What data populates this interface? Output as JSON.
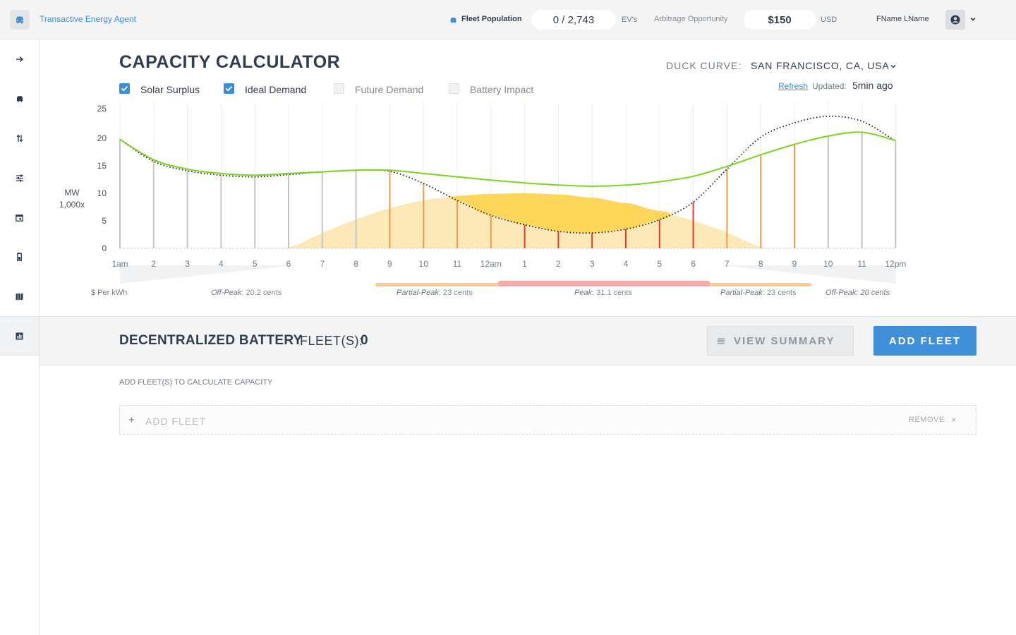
{
  "header": {
    "app_title": "Transactive Energy Agent",
    "fleet_population_label": "Fleet Population",
    "fleet_population_value": "0 / 2,743",
    "fleet_population_unit": "EV's",
    "arbitrage_label": "Arbitrage Opportunity",
    "arbitrage_value": "$150",
    "arbitrage_unit": "USD",
    "user_name": "FName LName"
  },
  "sidebar": {
    "items": [
      {
        "icon": "arrow-right-icon"
      },
      {
        "icon": "car-icon"
      },
      {
        "icon": "transfer-arrows-icon"
      },
      {
        "icon": "sliders-icon"
      },
      {
        "icon": "calendar-icon"
      },
      {
        "icon": "battery-icon"
      },
      {
        "icon": "map-icon"
      },
      {
        "icon": "bar-chart-icon",
        "active": true
      }
    ]
  },
  "calculator": {
    "title": "CAPACITY CALCULATOR",
    "duck_curve_label": "DUCK CURVE:",
    "duck_curve_value": "SAN FRANCISCO, CA, USA",
    "refresh_label": "Refresh",
    "updated_label": "Updated:",
    "updated_value": "5min ago",
    "checkboxes": [
      {
        "label": "Solar Surplus",
        "checked": true
      },
      {
        "label": "Ideal Demand",
        "checked": true
      },
      {
        "label": "Future Demand",
        "checked": false
      },
      {
        "label": "Battery Impact",
        "checked": false
      }
    ]
  },
  "chart_data": {
    "type": "line",
    "ylabel_line1": "MW",
    "ylabel_line2": "1,000x",
    "yticks": [
      0,
      5,
      10,
      15,
      20,
      25
    ],
    "ylim": [
      0,
      25
    ],
    "x": [
      "1am",
      "2",
      "3",
      "4",
      "5",
      "6",
      "7",
      "8",
      "9",
      "10",
      "11",
      "12am",
      "1",
      "2",
      "3",
      "4",
      "5",
      "6",
      "7",
      "8",
      "9",
      "10",
      "11",
      "12pm"
    ],
    "series": [
      {
        "key": "green",
        "color": "#7ed321",
        "values": [
          19.8,
          16.1,
          14.4,
          13.6,
          13.3,
          13.6,
          13.9,
          14.2,
          14.2,
          13.6,
          13.0,
          12.4,
          11.9,
          11.5,
          11.3,
          11.5,
          12.1,
          13.1,
          14.9,
          17.0,
          18.9,
          20.4,
          21.1,
          19.6
        ]
      },
      {
        "key": "dotted",
        "color": "#1a1a1a",
        "values": [
          19.8,
          15.8,
          14.1,
          13.3,
          13.0,
          13.4,
          13.9,
          14.2,
          14.0,
          11.8,
          8.7,
          6.0,
          4.3,
          3.1,
          2.8,
          3.5,
          5.2,
          8.4,
          14.4,
          20.2,
          22.8,
          24.0,
          23.1,
          19.5
        ]
      },
      {
        "key": "solar",
        "color": "#fde9b8",
        "values": [
          0,
          0,
          0,
          0,
          0,
          0.2,
          2.8,
          5.3,
          7.3,
          8.7,
          9.5,
          9.9,
          10.0,
          9.8,
          9.2,
          8.2,
          6.8,
          5.0,
          2.9,
          0.3,
          0,
          0,
          0,
          0
        ]
      }
    ],
    "bar_colors": [
      "gray",
      "gray",
      "gray",
      "gray",
      "gray",
      "gray",
      "gray",
      "gray",
      "orange",
      "orange",
      "orange",
      "orange",
      "red",
      "red",
      "red",
      "red",
      "red",
      "red",
      "orange",
      "orange",
      "orange",
      "gray",
      "gray",
      "gray"
    ],
    "colors": {
      "gray": "#c4c4c4",
      "orange": "#f49a4e",
      "red": "#e8382b",
      "solar_overlap": "#fdd65a"
    },
    "price_axis_label": "$ Per  kWh",
    "price_periods": [
      {
        "name": "Off-Peak",
        "rate": ": 20.2 cents"
      },
      {
        "name": "Partial-Peak",
        "rate": ": 23 cents"
      },
      {
        "name": "Peak",
        "rate": ": 31.1 cents"
      },
      {
        "name": "Partial-Peak",
        "rate": ": 23 cents"
      },
      {
        "name": "Off-Peak",
        "rate": ": 20 cents"
      }
    ]
  },
  "battery": {
    "title": "DECENTRALIZED BATTERY",
    "fleets_label": "FLEET(S):",
    "fleets_count": "0",
    "view_summary_label": "VIEW SUMMARY",
    "add_fleet_label": "ADD FLEET",
    "hint": "ADD FLEET(S) TO CALCULATE CAPACITY",
    "row_add_label": "ADD FLEET",
    "row_remove_label": "REMOVE"
  }
}
